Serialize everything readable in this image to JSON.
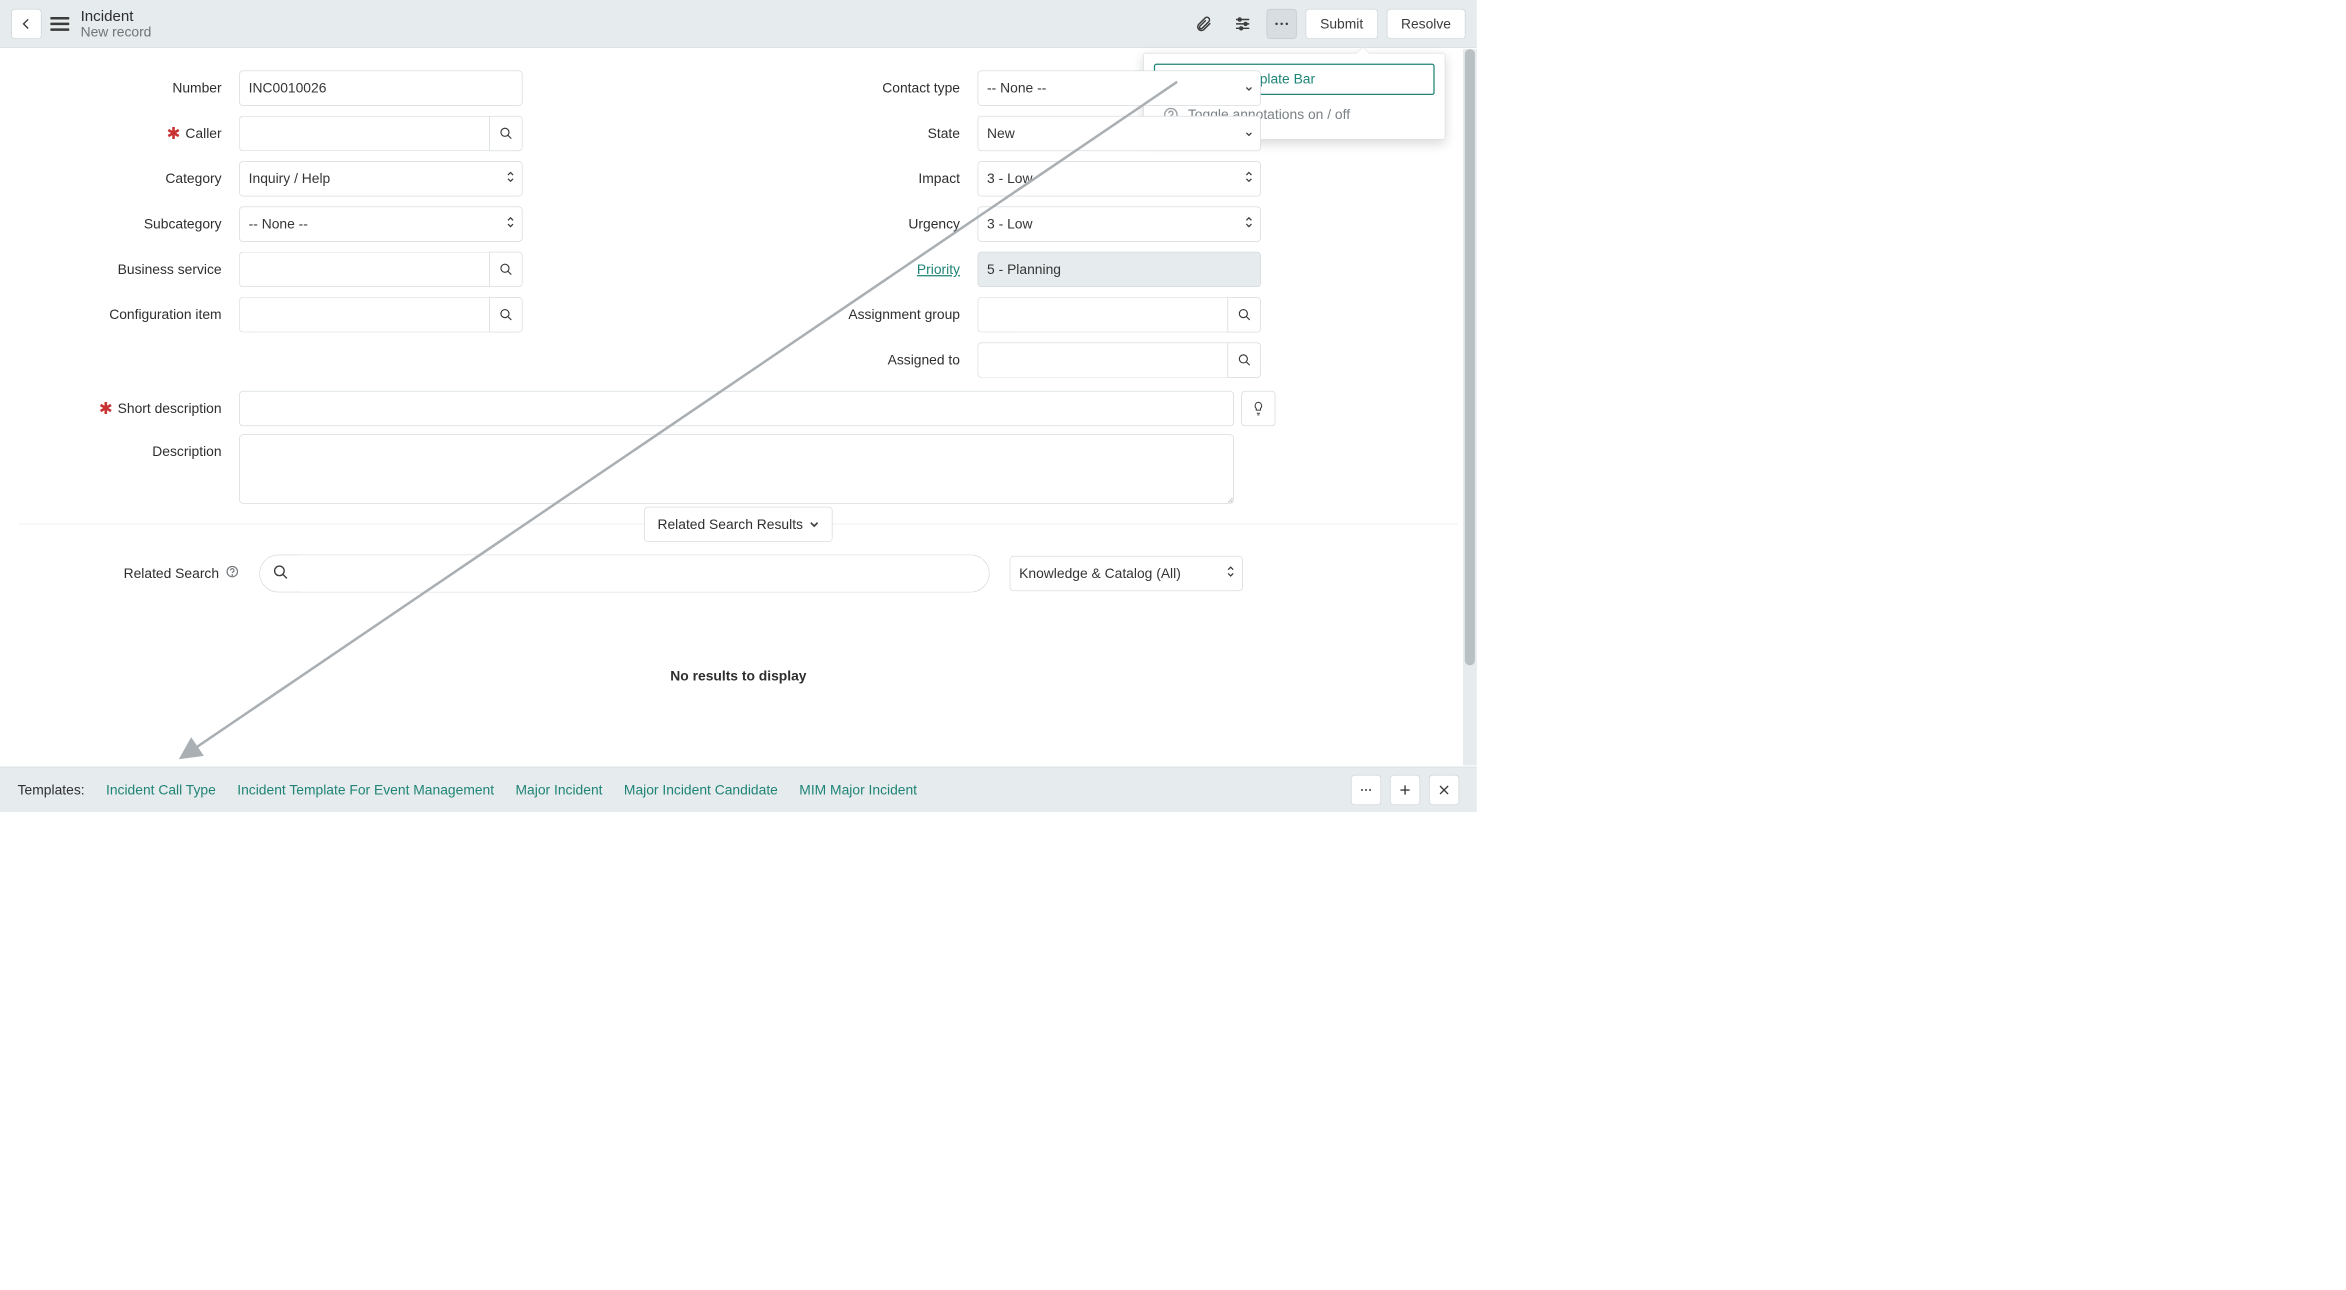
{
  "header": {
    "title": "Incident",
    "subtitle": "New record",
    "submit": "Submit",
    "resolve": "Resolve"
  },
  "popover": {
    "toggle_template": "Toggle Template Bar",
    "toggle_annotations": "Toggle annotations on / off"
  },
  "left": {
    "number_label": "Number",
    "number_value": "INC0010026",
    "caller_label": "Caller",
    "category_label": "Category",
    "category_value": "Inquiry / Help",
    "subcategory_label": "Subcategory",
    "subcategory_value": "-- None --",
    "business_service_label": "Business service",
    "config_item_label": "Configuration item"
  },
  "right": {
    "contact_type_label": "Contact type",
    "contact_type_value": "-- None --",
    "state_label": "State",
    "state_value": "New",
    "impact_label": "Impact",
    "impact_value": "3 - Low",
    "urgency_label": "Urgency",
    "urgency_value": "3 - Low",
    "priority_label": "Priority",
    "priority_value": "5 - Planning",
    "assignment_group_label": "Assignment group",
    "assigned_to_label": "Assigned to"
  },
  "wide": {
    "short_desc_label": "Short description",
    "desc_label": "Description"
  },
  "related": {
    "pill": "Related Search Results",
    "label": "Related Search",
    "sel_value": "Knowledge & Catalog (All)",
    "empty": "No results to display"
  },
  "templates": {
    "label": "Templates:",
    "items": [
      "Incident Call Type",
      "Incident Template For Event Management",
      "Major Incident",
      "Major Incident Candidate",
      "MIM Major Incident"
    ]
  }
}
